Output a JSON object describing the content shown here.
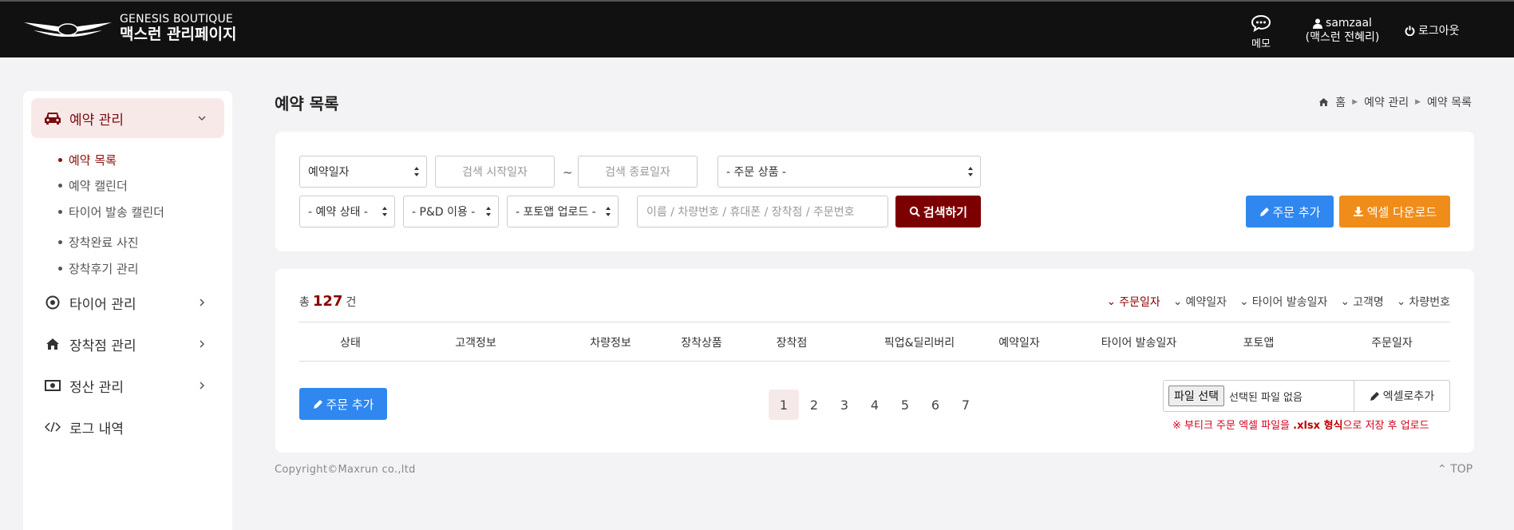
{
  "header": {
    "brand_sub": "GENESIS BOUTIQUE",
    "brand_main": "맥스런 관리페이지",
    "memo_label": "메모",
    "user_name": "samzaal",
    "user_org": "(맥스런 전혜리)",
    "logout_label": "로그아웃"
  },
  "sidebar": {
    "groups": [
      {
        "label": "예약 관리",
        "icon": "car-icon"
      },
      {
        "label": "타이어 관리",
        "icon": "tire-icon"
      },
      {
        "label": "장착점 관리",
        "icon": "home-icon"
      },
      {
        "label": "정산 관리",
        "icon": "money-icon"
      },
      {
        "label": "로그 내역",
        "icon": "code-icon"
      }
    ],
    "sub_items": [
      "예약 목록",
      "예약 캘린더",
      "타이어 발송 캘린더",
      "장착완료 사진",
      "장착후기 관리"
    ]
  },
  "page": {
    "title": "예약 목록",
    "breadcrumb": [
      "홈",
      "예약 관리",
      "예약 목록"
    ]
  },
  "filters": {
    "date_type": "예약일자",
    "start_placeholder": "검색 시작일자",
    "tilde": "~",
    "end_placeholder": "검색 종료일자",
    "product": "- 주문 상품 -",
    "status": "- 예약 상태 -",
    "pd": "- P&D 이용 -",
    "photo_upload": "- 포토앱 업로드 -",
    "search_placeholder": "이름 / 차량번호 / 휴대폰 / 장착점 / 주문번호",
    "search_button": "검색하기",
    "add_order": "주문 추가",
    "excel_download": "엑셀 다운로드"
  },
  "list": {
    "total_prefix": "총",
    "total_count": "127",
    "total_suffix": "건",
    "sorts": [
      "주문일자",
      "예약일자",
      "타이어 발송일자",
      "고객명",
      "차량번호"
    ],
    "columns": [
      "상태",
      "고객정보",
      "차량정보",
      "장착상품",
      "장착점",
      "픽업&딜리버리",
      "예약일자",
      "타이어 발송일자",
      "포토앱",
      "주문일자"
    ],
    "add_order": "주문 추가",
    "pages": [
      "1",
      "2",
      "3",
      "4",
      "5",
      "6",
      "7"
    ],
    "file_choose": "파일 선택",
    "file_none": "선택된 파일 없음",
    "excel_add": "엑셀로추가",
    "note_prefix": "※ 부티크 주문 엑셀 파일을 ",
    "note_bold": ".xlsx 형식",
    "note_suffix": "으로 저장 후 업로드"
  },
  "footer": {
    "copyright": "Copyright©Maxrun co.,ltd",
    "top": "TOP"
  },
  "colors": {
    "accent": "#7d0000",
    "blue": "#2f87ef",
    "orange": "#f08d1a"
  }
}
